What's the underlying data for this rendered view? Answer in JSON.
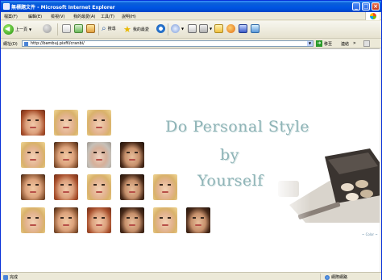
{
  "window": {
    "title": "無標題文件 - Microsoft Internet Explorer"
  },
  "menubar": {
    "items": [
      "檔案(F)",
      "編輯(E)",
      "檢視(V)",
      "我的最愛(A)",
      "工具(T)",
      "說明(H)"
    ]
  },
  "toolbar": {
    "back_label": "上一頁",
    "search_label": "搜尋",
    "favorites_label": "我的最愛"
  },
  "addressbar": {
    "label": "網址(D)",
    "url": "http://bambuj.pixfil/cranbi/",
    "go_label": "移至",
    "links_label": "連結"
  },
  "page": {
    "headline_line1": "Do  Personal  Style",
    "headline_line2": "by",
    "headline_line3": "Yourself",
    "caption": "~ Color ~"
  },
  "statusbar": {
    "left_text": "完成",
    "right_text": "網際網路"
  },
  "colors": {
    "title_bar": "#0054e3",
    "headline": "#8fb4b7",
    "chrome": "#ece9d8"
  }
}
